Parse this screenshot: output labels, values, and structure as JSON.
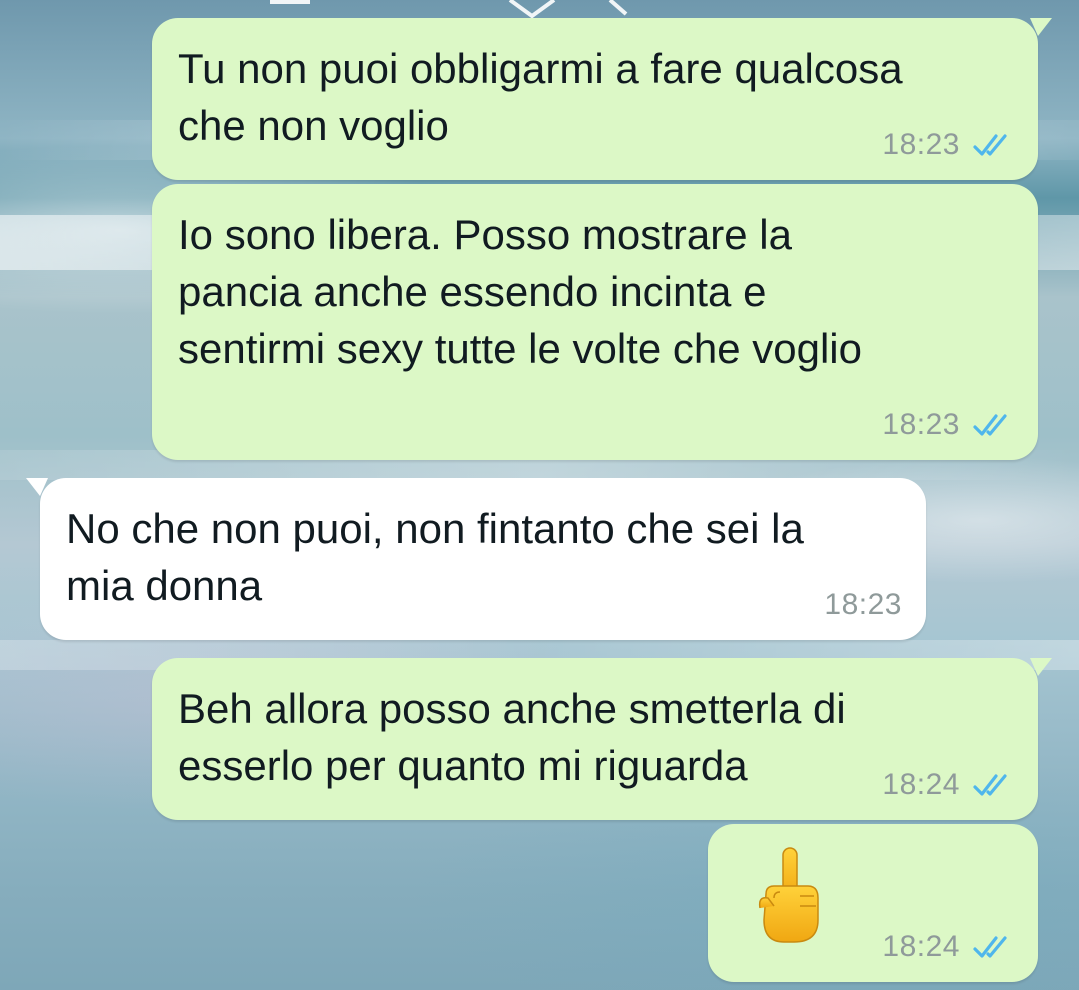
{
  "chat": {
    "messages": [
      {
        "direction": "outgoing",
        "text": "Tu non puoi obbligarmi a fare qualcosa\nche non voglio",
        "time": "18:23",
        "status": "read",
        "status_icon": "double-check-icon"
      },
      {
        "direction": "outgoing",
        "text": "Io sono libera. Posso mostrare la\npancia anche essendo incinta e\nsentirmi sexy tutte le volte che voglio",
        "time": "18:23",
        "status": "read",
        "status_icon": "double-check-icon"
      },
      {
        "direction": "incoming",
        "text": "No che non puoi, non fintanto che sei la\nmia donna",
        "time": "18:23"
      },
      {
        "direction": "outgoing",
        "text": "Beh allora posso anche smetterla di\nesserlo per quanto mi riguarda",
        "time": "18:24",
        "status": "read",
        "status_icon": "double-check-icon"
      },
      {
        "direction": "outgoing",
        "emoji": "middle-finger-emoji",
        "time": "18:24",
        "status": "read",
        "status_icon": "double-check-icon"
      }
    ]
  },
  "colors": {
    "outgoing_bubble": "#dcf8c6",
    "incoming_bubble": "#ffffff",
    "read_ticks": "#4fb6ec",
    "timestamp": "#8f9a9a"
  }
}
